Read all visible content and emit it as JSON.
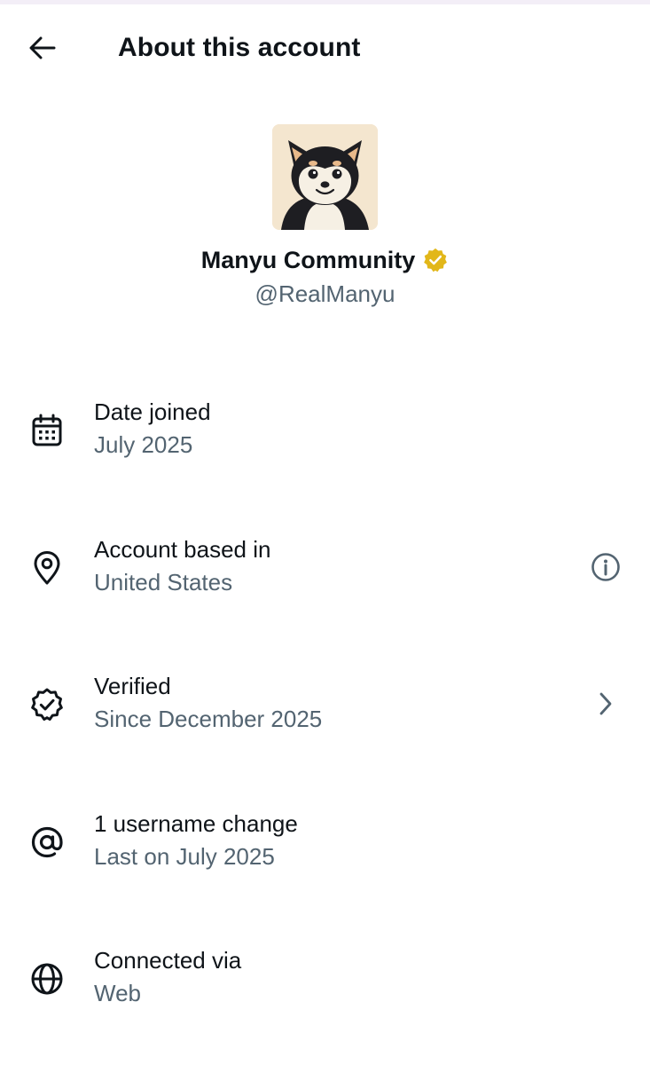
{
  "header": {
    "title": "About this account",
    "back_icon": "arrow-left-icon"
  },
  "profile": {
    "display_name": "Manyu Community",
    "handle": "@RealManyu",
    "verified_badge_color": "#e2b719",
    "avatar_description_icon": "shiba-inu-avatar"
  },
  "rows": [
    {
      "icon": "calendar-icon",
      "label": "Date joined",
      "value": "July 2025"
    },
    {
      "icon": "location-pin-icon",
      "label": "Account based in",
      "value": "United States",
      "action_icon": "info-icon"
    },
    {
      "icon": "verified-badge-outline-icon",
      "label": "Verified",
      "value": "Since December 2025",
      "action_icon": "chevron-right-icon"
    },
    {
      "icon": "at-sign-icon",
      "label": "1 username change",
      "value": "Last on July 2025"
    },
    {
      "icon": "globe-icon",
      "label": "Connected via",
      "value": "Web"
    }
  ],
  "colors": {
    "primary_text": "#0f1419",
    "secondary_text": "#536471",
    "background": "#ffffff",
    "gold_badge": "#e2b719"
  }
}
